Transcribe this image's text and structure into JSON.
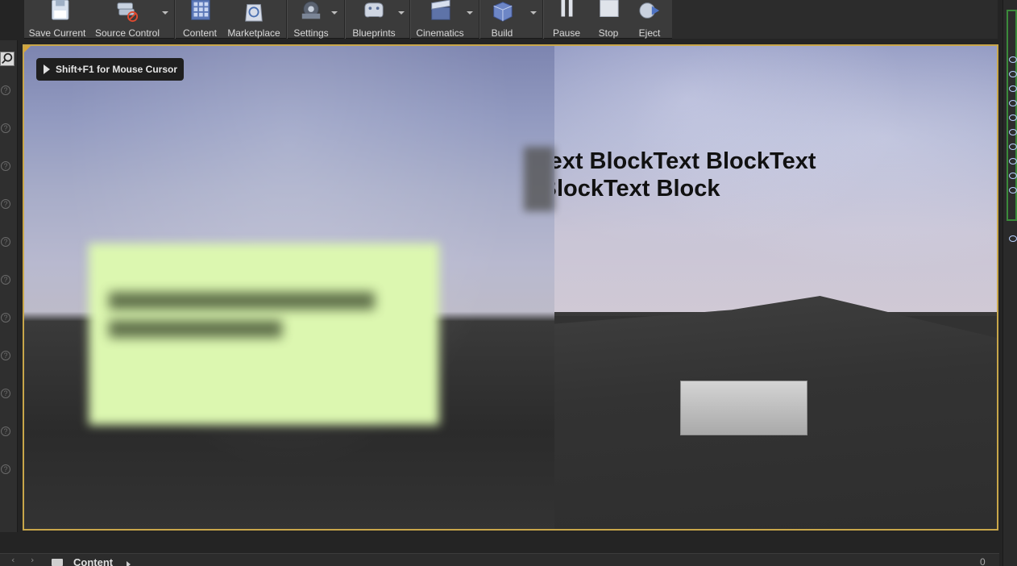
{
  "toolbar": {
    "buttons": [
      {
        "label": "Save Current",
        "icon": "floppy-disk-icon"
      },
      {
        "label": "Source Control",
        "icon": "source-control-icon"
      },
      {
        "label": "Content",
        "icon": "content-grid-icon"
      },
      {
        "label": "Marketplace",
        "icon": "marketplace-bag-icon"
      },
      {
        "label": "Settings",
        "icon": "settings-gear-icon"
      },
      {
        "label": "Blueprints",
        "icon": "blueprint-gamepad-icon"
      },
      {
        "label": "Cinematics",
        "icon": "clapperboard-icon"
      },
      {
        "label": "Build",
        "icon": "build-cube-icon"
      },
      {
        "label": "Pause",
        "icon": "pause-icon"
      },
      {
        "label": "Stop",
        "icon": "stop-icon"
      },
      {
        "label": "Eject",
        "icon": "eject-icon"
      }
    ]
  },
  "viewport": {
    "hint": "Shift+F1 for Mouse Cursor",
    "text_line1": "Text BlockText BlockText",
    "text_line2": "BlockText Block"
  },
  "content_browser": {
    "path": "Content",
    "count": "0"
  },
  "colors": {
    "viewport_border": "#c8a64a",
    "card": "#dcf7b0",
    "panel_green": "#3b8a3b"
  }
}
